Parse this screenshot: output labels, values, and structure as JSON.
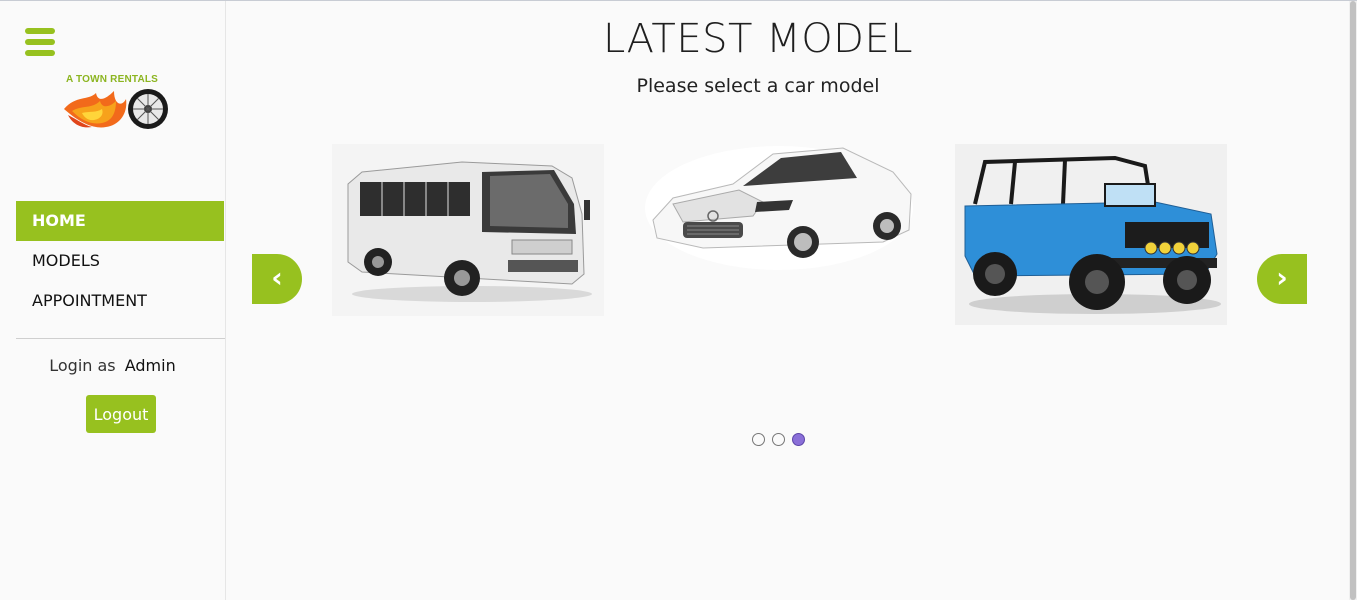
{
  "sidebar": {
    "logo_text": "A TOWN RENTALS",
    "nav": [
      {
        "label": "HOME",
        "active": true
      },
      {
        "label": "MODELS",
        "active": false
      },
      {
        "label": "APPOINTMENT",
        "active": false
      }
    ],
    "login_prefix": "Login as",
    "login_user": "Admin",
    "logout_label": "Logout"
  },
  "main": {
    "title": "LATEST MODEL",
    "subtitle": "Please select a car model",
    "prev_label": "‹",
    "next_label": "›",
    "slides": [
      {
        "icon": "minibus-image"
      },
      {
        "icon": "white-sedan-image"
      },
      {
        "icon": "blue-jeep-image"
      }
    ],
    "dots": {
      "count": 3,
      "active_index": 3
    }
  },
  "colors": {
    "accent": "#97c11f",
    "active_dot": "#8a6fd8"
  }
}
